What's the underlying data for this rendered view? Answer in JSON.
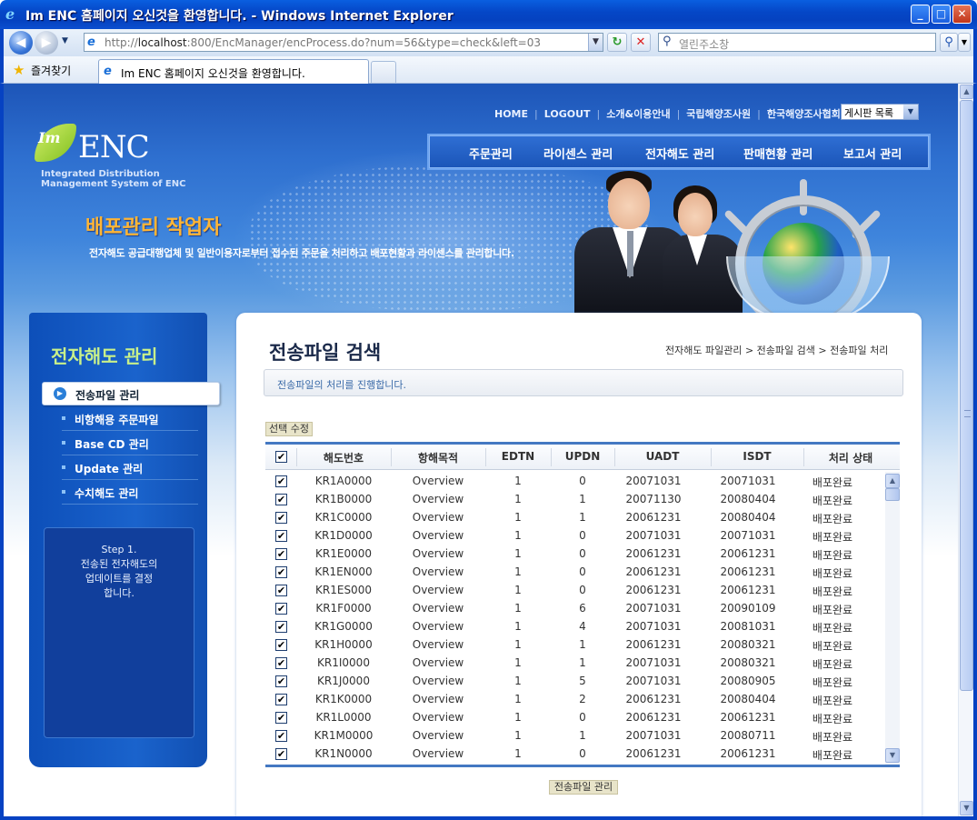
{
  "window": {
    "title": "Im ENC 홈페이지 오신것을 환영합니다. - Windows Internet Explorer",
    "min": "_",
    "max": "□",
    "close": "✕"
  },
  "browser": {
    "url_prefix": "http://",
    "url_host": "localhost",
    "url_rest": ":800/EncManager/encProcess.do?num=56&type=check&left=03",
    "search_placeholder": "열린주소창",
    "favorites_label": "즐겨찾기",
    "tab_title": "Im ENC 홈페이지 오신것을 환영합니다."
  },
  "site": {
    "top_links": [
      "HOME",
      "LOGOUT",
      "소개&이용안내",
      "국립해양조사원",
      "한국해양조사협회"
    ],
    "board_select": "게시판 목록",
    "main_nav": [
      "주문관리",
      "라이센스 관리",
      "전자해도 관리",
      "판매현황 관리",
      "보고서 관리"
    ],
    "logo_im": "Im",
    "logo_enc": "ENC",
    "logo_sub1": "Integrated Distribution",
    "logo_sub2": "Management System of ENC",
    "worker_title": "배포관리 작업자",
    "worker_desc": "전자해도 공급대행업체 및 일반이용자로부터 접수된 주문을 처리하고 배포현황과 라이센스를 관리합니다."
  },
  "sidebar": {
    "title": "전자해도 관리",
    "active": "전송파일 관리",
    "items": [
      "비항해용 주문파일",
      "Base CD 관리",
      "Update 관리",
      "수치해도 관리"
    ],
    "step": [
      "Step 1.",
      "전송된 전자해도의",
      "업데이트를 결정",
      "합니다."
    ]
  },
  "main": {
    "title": "전송파일 검색",
    "breadcrumb": "전자해도 파일관리 > 전송파일 검색 > 전송파일 처리",
    "info": "전송파일의 처리를 진행합니다.",
    "edit_button": "선택 수정",
    "manage_button": "전송파일 관리",
    "columns": [
      "해도번호",
      "항해목적",
      "EDTN",
      "UPDN",
      "UADT",
      "ISDT",
      "처리 상태"
    ],
    "rows": [
      {
        "no": "KR1A0000",
        "purpose": "Overview",
        "edtn": "1",
        "updn": "0",
        "uadt": "20071031",
        "isdt": "20071031",
        "status": "배포완료"
      },
      {
        "no": "KR1B0000",
        "purpose": "Overview",
        "edtn": "1",
        "updn": "1",
        "uadt": "20071130",
        "isdt": "20080404",
        "status": "배포완료"
      },
      {
        "no": "KR1C0000",
        "purpose": "Overview",
        "edtn": "1",
        "updn": "1",
        "uadt": "20061231",
        "isdt": "20080404",
        "status": "배포완료"
      },
      {
        "no": "KR1D0000",
        "purpose": "Overview",
        "edtn": "1",
        "updn": "0",
        "uadt": "20071031",
        "isdt": "20071031",
        "status": "배포완료"
      },
      {
        "no": "KR1E0000",
        "purpose": "Overview",
        "edtn": "1",
        "updn": "0",
        "uadt": "20061231",
        "isdt": "20061231",
        "status": "배포완료"
      },
      {
        "no": "KR1EN000",
        "purpose": "Overview",
        "edtn": "1",
        "updn": "0",
        "uadt": "20061231",
        "isdt": "20061231",
        "status": "배포완료"
      },
      {
        "no": "KR1ES000",
        "purpose": "Overview",
        "edtn": "1",
        "updn": "0",
        "uadt": "20061231",
        "isdt": "20061231",
        "status": "배포완료"
      },
      {
        "no": "KR1F0000",
        "purpose": "Overview",
        "edtn": "1",
        "updn": "6",
        "uadt": "20071031",
        "isdt": "20090109",
        "status": "배포완료"
      },
      {
        "no": "KR1G0000",
        "purpose": "Overview",
        "edtn": "1",
        "updn": "4",
        "uadt": "20071031",
        "isdt": "20081031",
        "status": "배포완료"
      },
      {
        "no": "KR1H0000",
        "purpose": "Overview",
        "edtn": "1",
        "updn": "1",
        "uadt": "20061231",
        "isdt": "20080321",
        "status": "배포완료"
      },
      {
        "no": "KR1I0000",
        "purpose": "Overview",
        "edtn": "1",
        "updn": "1",
        "uadt": "20071031",
        "isdt": "20080321",
        "status": "배포완료"
      },
      {
        "no": "KR1J0000",
        "purpose": "Overview",
        "edtn": "1",
        "updn": "5",
        "uadt": "20071031",
        "isdt": "20080905",
        "status": "배포완료"
      },
      {
        "no": "KR1K0000",
        "purpose": "Overview",
        "edtn": "1",
        "updn": "2",
        "uadt": "20061231",
        "isdt": "20080404",
        "status": "배포완료"
      },
      {
        "no": "KR1L0000",
        "purpose": "Overview",
        "edtn": "1",
        "updn": "0",
        "uadt": "20061231",
        "isdt": "20061231",
        "status": "배포완료"
      },
      {
        "no": "KR1M0000",
        "purpose": "Overview",
        "edtn": "1",
        "updn": "1",
        "uadt": "20071031",
        "isdt": "20080711",
        "status": "배포완료"
      },
      {
        "no": "KR1N0000",
        "purpose": "Overview",
        "edtn": "1",
        "updn": "0",
        "uadt": "20061231",
        "isdt": "20061231",
        "status": "배포완료"
      }
    ]
  }
}
